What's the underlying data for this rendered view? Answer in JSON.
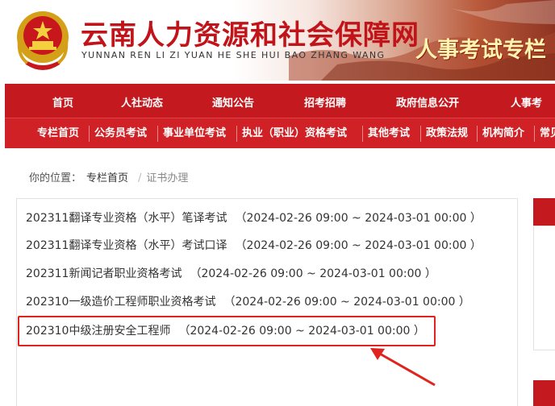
{
  "header": {
    "site_title": "云南人力资源和社会保障网",
    "site_subtitle": "YUNNAN REN LI ZI YUAN HE SHE HUI BAO ZHANG WANG",
    "column_title": "人事考试专栏"
  },
  "main_nav": [
    "首页",
    "人社动态",
    "通知公告",
    "招考招聘",
    "政府信息公开",
    "人事考"
  ],
  "sub_nav": [
    "专栏首页",
    "公务员考试",
    "事业单位考试",
    "执业（职业）资格考试",
    "其他考试",
    "政策法规",
    "机构简介",
    "常见"
  ],
  "breadcrumb": {
    "prefix": "你的位置：",
    "home": "专栏首页",
    "separator": "/",
    "current": "证书办理"
  },
  "list": [
    {
      "title": "202311翻译专业资格（水平）笔译考试",
      "time": "（2024-02-26 09:00 ~ 2024-03-01 00:00 ）"
    },
    {
      "title": "202311翻译专业资格（水平）考试口译",
      "time": "（2024-02-26 09:00 ~ 2024-03-01 00:00 ）"
    },
    {
      "title": "202311新闻记者职业资格考试",
      "time": "（2024-02-26 09:00 ~ 2024-03-01 00:00 ）"
    },
    {
      "title": "202310一级造价工程师职业资格考试",
      "time": "（2024-02-26 09:00 ~ 2024-03-01 00:00 ）"
    },
    {
      "title": "202310中级注册安全工程师",
      "time": "（2024-02-26 09:00 ~ 2024-03-01 00:00 ）"
    }
  ],
  "colors": {
    "primary_red": "#c41a1f",
    "highlight_red": "#e0231f",
    "text": "#333333"
  }
}
